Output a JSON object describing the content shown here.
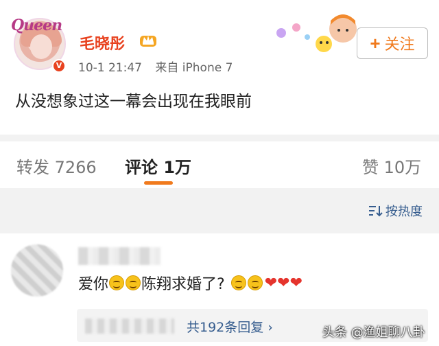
{
  "post": {
    "avatar_text": "Queen",
    "verified_badge": "V",
    "username": "毛晓彤",
    "time": "10-1 21:47",
    "source": "来自 iPhone 7",
    "follow_label": "关注",
    "follow_icon": "+",
    "content": "从没想象过这一幕会出现在我眼前"
  },
  "tabs": {
    "repost": "转发 7266",
    "comments": "评论 1万",
    "likes": "赞 10万",
    "accent": "#f07a1d"
  },
  "sort": {
    "icon": "sort-icon",
    "label": "按热度"
  },
  "comment": {
    "text_a": "爱你",
    "text_b": "陈翔求婚了?",
    "hearts": "❤❤❤",
    "reply_count": "共192条回复 ›"
  },
  "watermark": "头条 @渔姐聊八卦",
  "colors": {
    "username": "#e8421f",
    "link": "#355c8e",
    "heart": "#e5342d"
  }
}
